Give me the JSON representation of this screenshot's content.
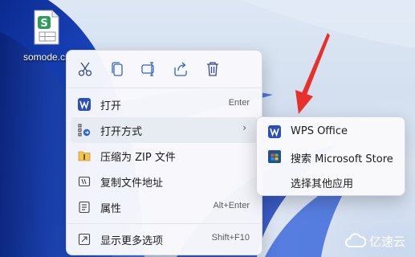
{
  "desktop": {
    "file_label": "somode.cs"
  },
  "context_menu": {
    "toolbar": [
      {
        "name": "cut-icon",
        "tooltip": ""
      },
      {
        "name": "copy-icon",
        "tooltip": ""
      },
      {
        "name": "rename-icon",
        "tooltip": ""
      },
      {
        "name": "share-icon",
        "tooltip": ""
      },
      {
        "name": "delete-icon",
        "tooltip": ""
      }
    ],
    "items": [
      {
        "label": "打开",
        "shortcut": "Enter",
        "icon": "wps-icon"
      },
      {
        "label": "打开方式",
        "shortcut": "",
        "icon": "open-with-icon",
        "has_submenu": true,
        "highlighted": true
      },
      {
        "label": "压缩为 ZIP 文件",
        "shortcut": "",
        "icon": "zip-icon"
      },
      {
        "label": "复制文件地址",
        "shortcut": "",
        "icon": "copy-path-icon"
      },
      {
        "label": "属性",
        "shortcut": "Alt+Enter",
        "icon": "properties-icon"
      },
      {
        "label": "显示更多选项",
        "shortcut": "Shift+F10",
        "icon": "more-options-icon"
      }
    ]
  },
  "submenu": {
    "items": [
      {
        "label": "WPS Office",
        "icon": "wps-office-icon"
      },
      {
        "label": "搜索 Microsoft Store",
        "icon": "store-icon"
      },
      {
        "label": "选择其他应用",
        "icon": ""
      }
    ]
  },
  "watermark": {
    "text": "亿速云"
  },
  "colors": {
    "wps_red": "#c7332d",
    "arrow_red": "#e8302a",
    "wallpaper_blue": "#1a3fb5",
    "menu_bg": "#f9f9fc",
    "highlight": "#e7ebf2"
  }
}
